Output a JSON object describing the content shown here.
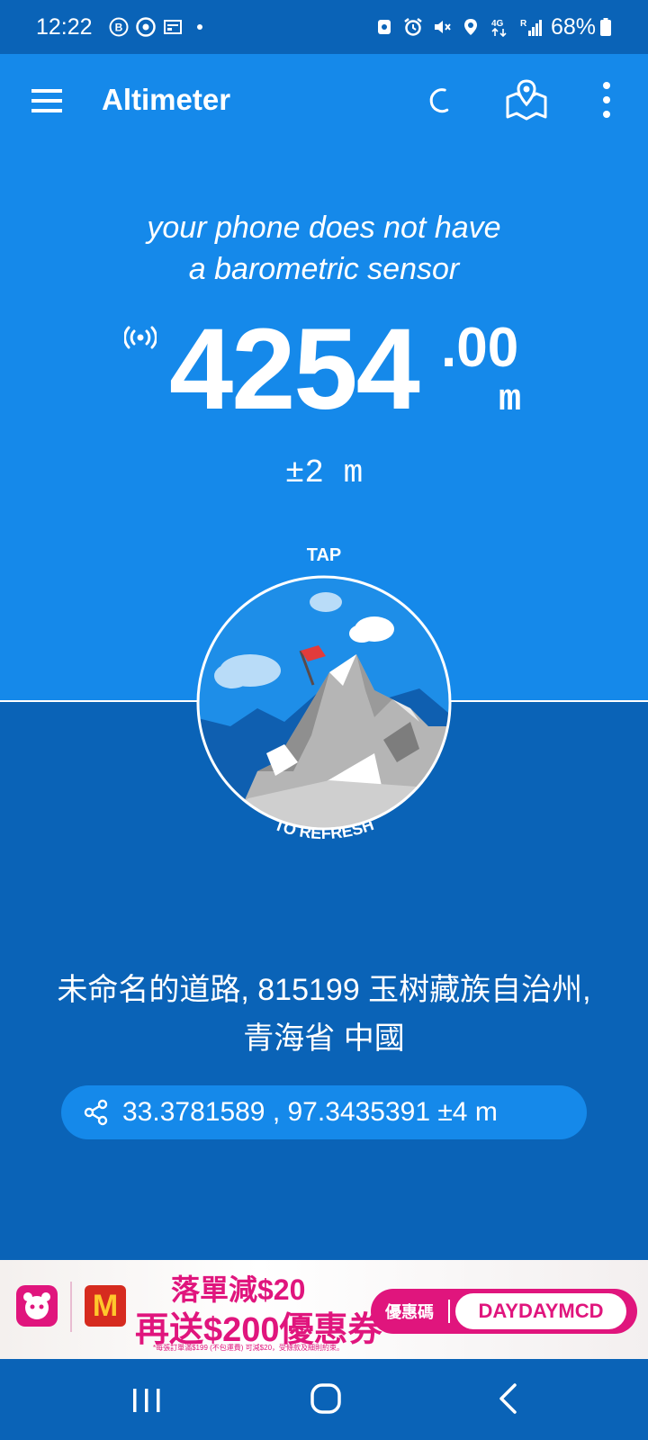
{
  "status_bar": {
    "time": "12:22",
    "battery": "68%",
    "left_icons": [
      "b-circle-icon",
      "chrome-icon",
      "news-icon",
      "dot-icon"
    ],
    "right_icons": [
      "shield-icon",
      "alarm-icon",
      "mute-icon",
      "location-icon",
      "network-4g-icon",
      "signal-icon",
      "battery-icon"
    ],
    "network_label": "4G",
    "signal_label": "R"
  },
  "app_bar": {
    "title": "Altimeter",
    "icons": [
      "menu-icon",
      "moon-icon",
      "map-marker-icon",
      "more-vert-icon"
    ]
  },
  "main": {
    "sensor_message_line1": "your phone does not have",
    "sensor_message_line2": "a barometric sensor",
    "altitude_integer": "4254",
    "altitude_decimal": ".00",
    "altitude_unit": "m",
    "accuracy": "±2 m",
    "tap_label": "TAP",
    "refresh_label": "TO REFRESH"
  },
  "location": {
    "address_line1": "未命名的道路, 815199 玉树藏族自治州,",
    "address_line2": "青海省 中國",
    "coordinates": "33.3781589 , 97.3435391 ±4 m"
  },
  "ad": {
    "line1": "落單減$20",
    "line2": "再送$200優惠券",
    "fine_print": "*每張訂單滿$199 (不包運費) 可減$20，受條款及細則約束。",
    "code_label": "優惠碼",
    "code": "DAYDAYMCD",
    "m_logo": "M"
  },
  "nav_bar": {
    "icons": [
      "recents-icon",
      "home-icon",
      "back-icon"
    ]
  },
  "colors": {
    "top_blue": "#1589ea",
    "dark_blue": "#0a63b7",
    "ad_pink": "#e0157d"
  }
}
